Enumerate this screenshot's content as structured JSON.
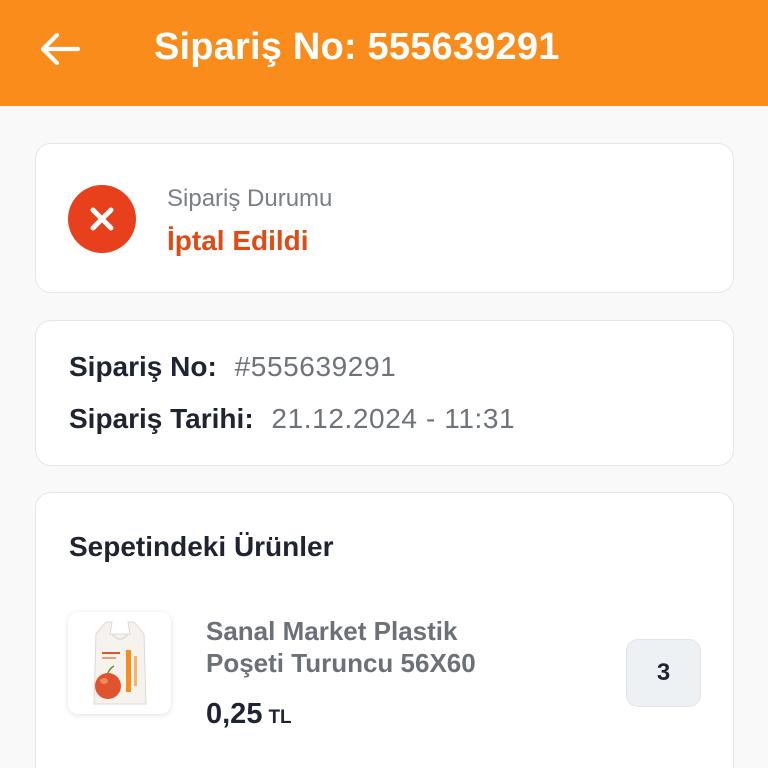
{
  "header": {
    "title": "Sipariş No: 555639291",
    "back_icon": "arrow-left-icon",
    "background": "#f98c1b"
  },
  "status": {
    "caption": "Sipariş Durumu",
    "value": "İptal Edildi",
    "icon": "cancel-x-icon",
    "icon_color": "#e8401c",
    "value_color": "#e04a14"
  },
  "order_info": {
    "order_no_label": "Sipariş No:",
    "order_no_value": "#555639291",
    "date_label": "Sipariş Tarihi:",
    "date_value": "21.12.2024 - 11:31"
  },
  "products": {
    "title": "Sepetindeki Ürünler",
    "items": [
      {
        "name": "Sanal Market Plastik Poşeti Turuncu 56X60",
        "price": "0,25",
        "currency": "TL",
        "quantity": "3",
        "image_icon": "shopping-bag-icon"
      }
    ]
  }
}
